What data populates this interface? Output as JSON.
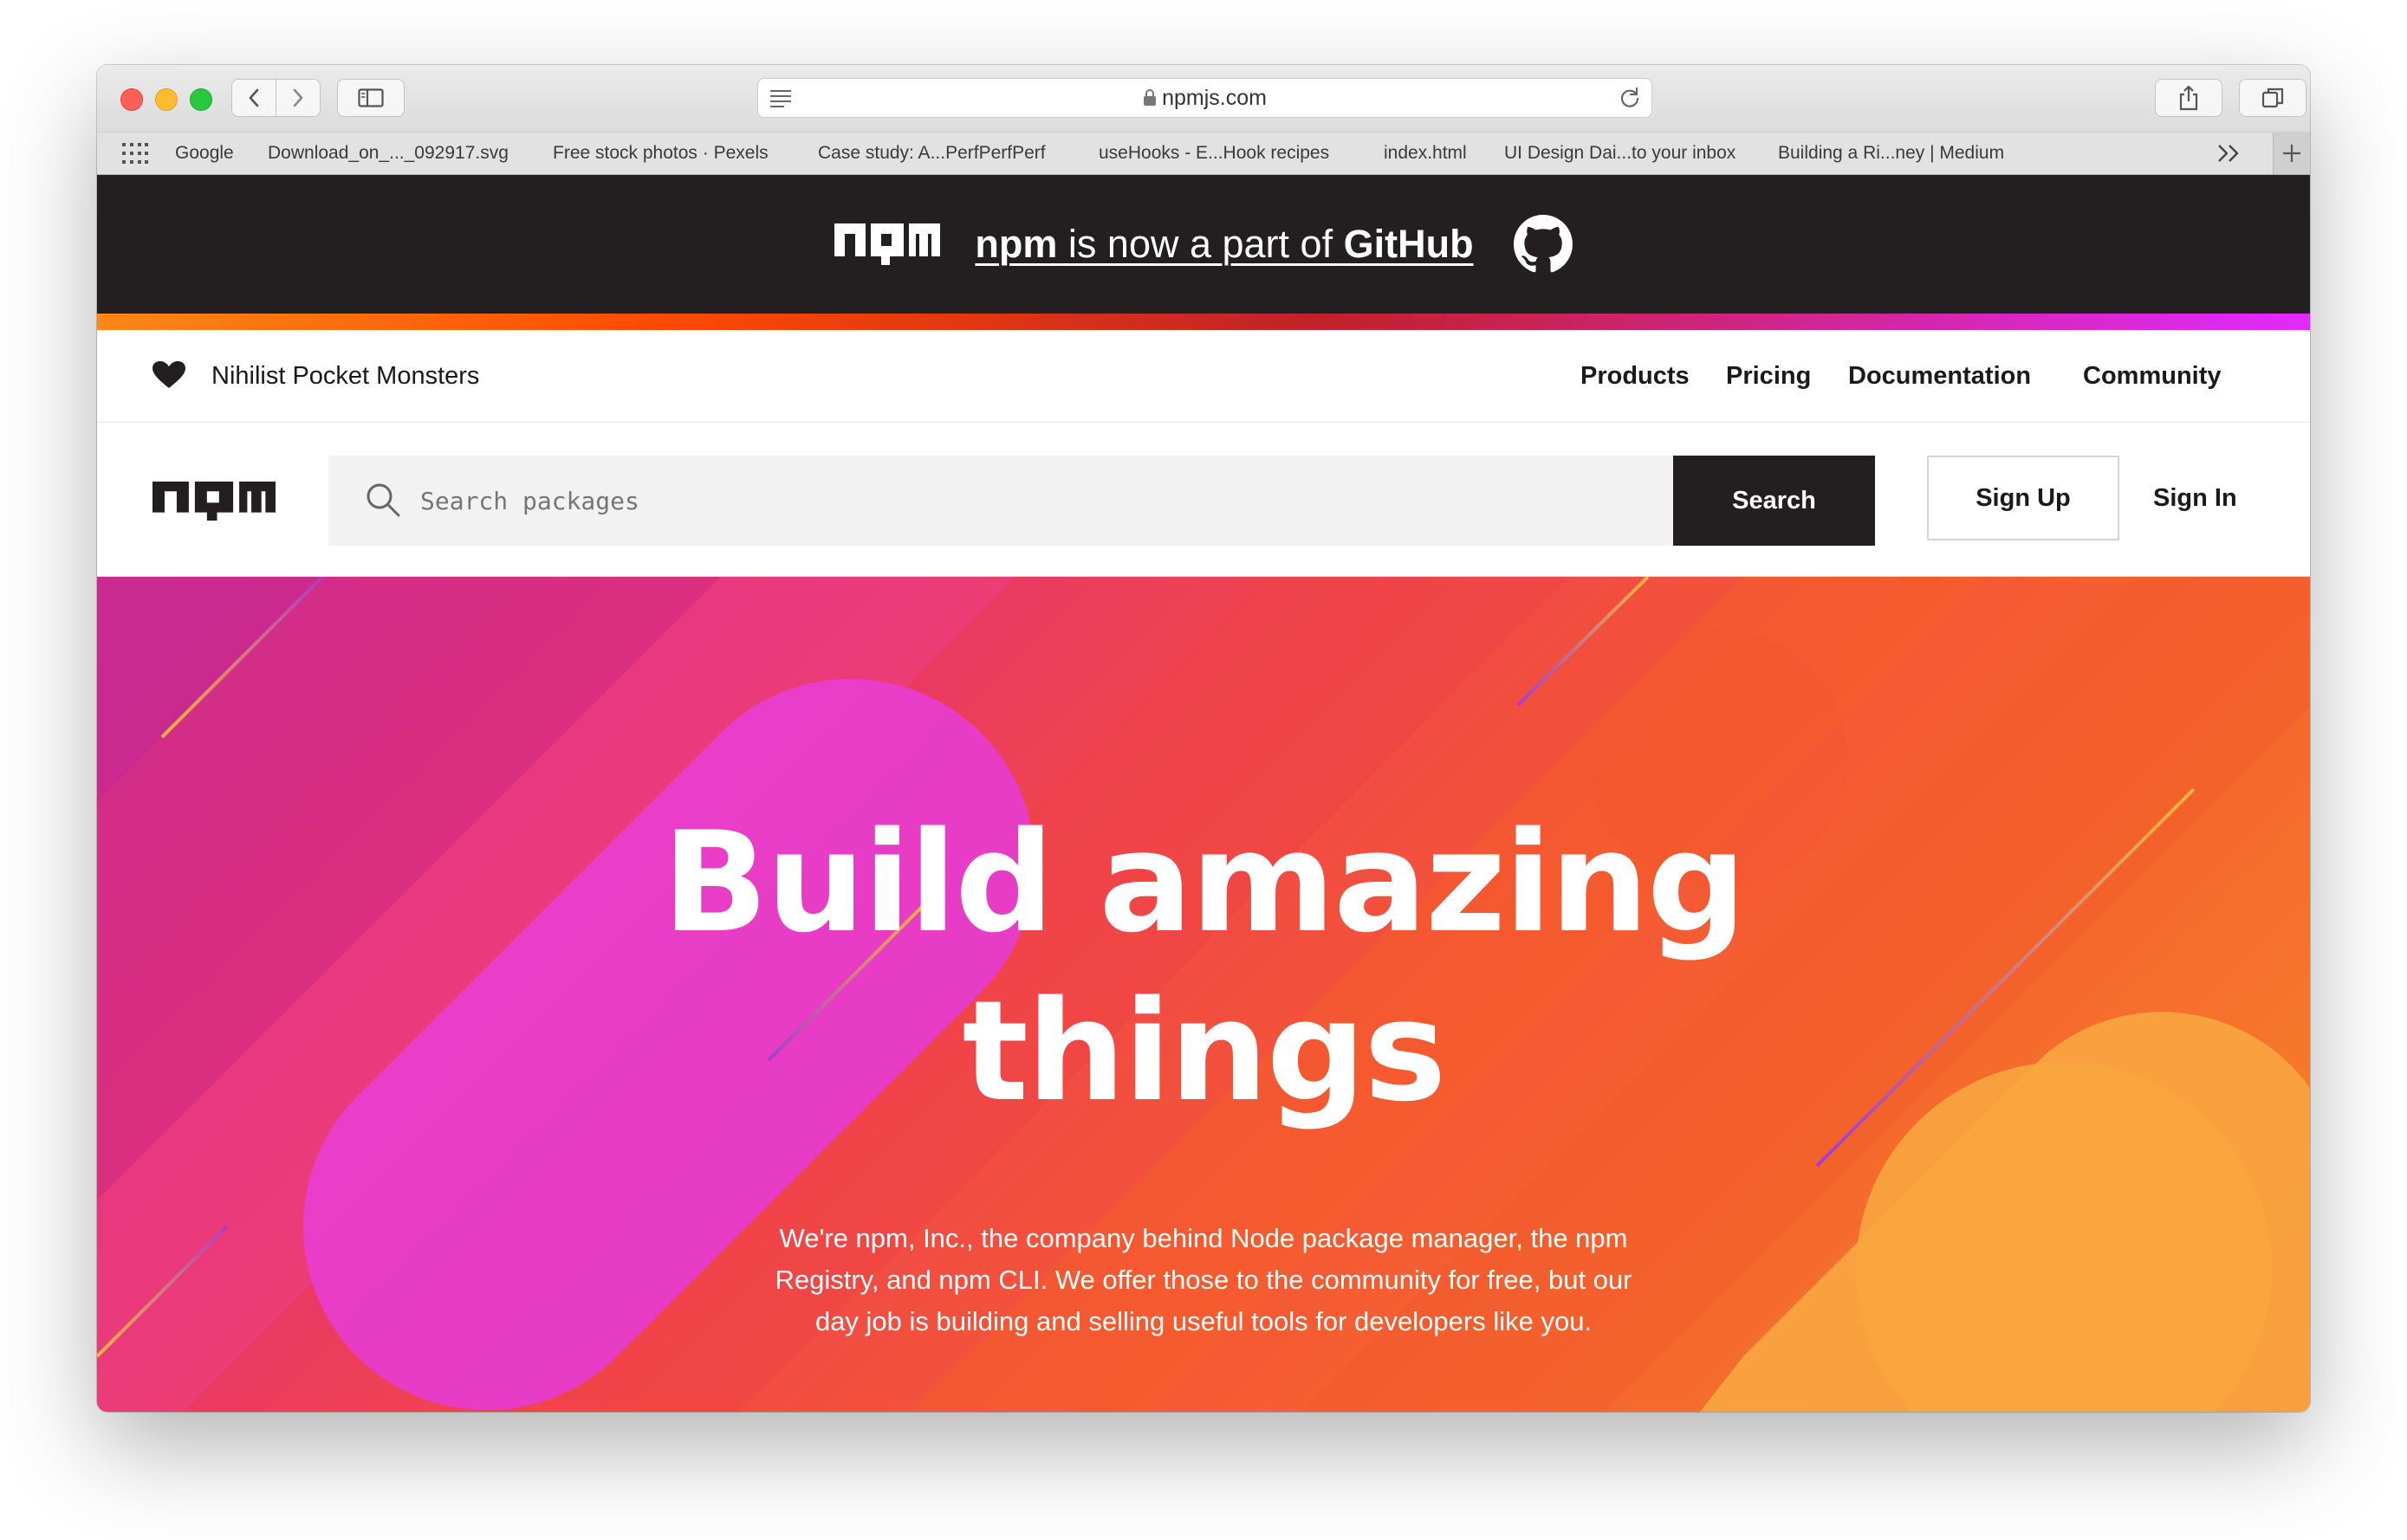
{
  "browser": {
    "url": "npmjs.com",
    "bookmarks": [
      "Google",
      "Download_on_..._092917.svg",
      "Free stock photos · Pexels",
      "Case study: A...PerfPerfPerf",
      "useHooks - E...Hook recipes",
      "index.html",
      "UI Design Dai...to your inbox",
      "Building a Ri...ney | Medium"
    ]
  },
  "banner": {
    "prefix": "npm",
    "middle": " is now a part of ",
    "suffix": "GitHub"
  },
  "topnav": {
    "org_name": "Nihilist Pocket Monsters",
    "links": [
      "Products",
      "Pricing",
      "Documentation",
      "Community"
    ]
  },
  "search": {
    "placeholder": "Search packages",
    "button_label": "Search",
    "signup_label": "Sign Up",
    "signin_label": "Sign In"
  },
  "hero": {
    "title_line1": "Build amazing",
    "title_line2": "things",
    "description": "We're npm, Inc., the company behind Node package manager, the npm Registry, and npm CLI. We offer those to the community for free, but our day job is building and selling useful tools for developers like you."
  },
  "colors": {
    "banner_bg": "#231f20",
    "hero_pink": "#e4306f",
    "hero_orange": "#f66a2c",
    "search_btn": "#231f20"
  }
}
